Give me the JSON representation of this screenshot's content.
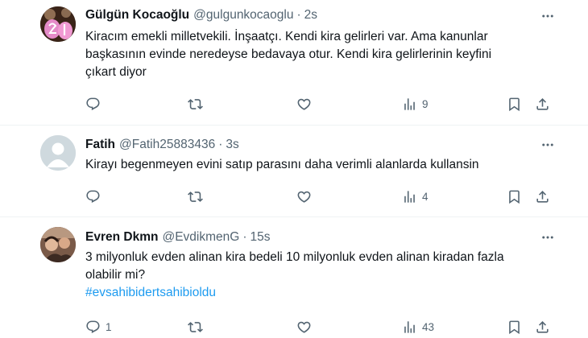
{
  "tweets": [
    {
      "name": "Gülgün Kocaoğlu",
      "handle": "@gulgunkocaoglu",
      "separator": "·",
      "time": "2s",
      "lines": [
        "Kiracım emekli milletvekili. İnşaatçı. Kendi kira gelirleri var.  Ama kanunlar",
        "başkasının evinde neredeyse bedavaya otur. Kendi kira gelirlerinin keyfini",
        "çıkart diyor"
      ],
      "hashtag": "",
      "stats": {
        "replies": "",
        "reposts": "",
        "likes": "",
        "views": "9"
      }
    },
    {
      "name": "Fatih",
      "handle": "@Fatih25883436",
      "separator": "·",
      "time": "3s",
      "lines": [
        "Kirayı begenmeyen evini satıp parasını daha verimli alanlarda kullansin"
      ],
      "hashtag": "",
      "stats": {
        "replies": "",
        "reposts": "",
        "likes": "",
        "views": "4"
      }
    },
    {
      "name": "Evren Dkmn",
      "handle": "@EvdikmenG",
      "separator": "·",
      "time": "15s",
      "lines": [
        "3 milyonluk evden alinan kira bedeli 10 milyonluk evden alinan kiradan fazla",
        "olabilir mi?"
      ],
      "hashtag": "#evsahibidertsahibioldu",
      "stats": {
        "replies": "1",
        "reposts": "",
        "likes": "",
        "views": "43"
      }
    }
  ],
  "colors": {
    "text": "#0f1419",
    "secondary": "#536471",
    "link": "#1d9bf0",
    "divider": "#eff3f4",
    "background": "#ffffff"
  },
  "icons": [
    "more-icon",
    "reply-icon",
    "repost-icon",
    "like-icon",
    "views-icon",
    "bookmark-icon",
    "share-icon"
  ]
}
